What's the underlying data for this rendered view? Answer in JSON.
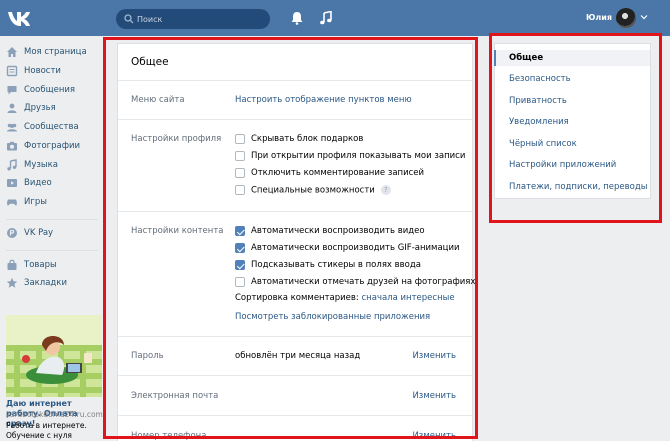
{
  "header": {
    "logo": "VK",
    "search_placeholder": "Поиск",
    "username": "Юлия",
    "icons": [
      "vk-logo-icon",
      "search-icon",
      "bell-icon",
      "music-icon",
      "chevron-down-icon"
    ]
  },
  "sidebar": {
    "items": [
      {
        "label": "Моя страница",
        "icon": "home-icon"
      },
      {
        "label": "Новости",
        "icon": "news-icon"
      },
      {
        "label": "Сообщения",
        "icon": "chat-icon"
      },
      {
        "label": "Друзья",
        "icon": "friend-icon"
      },
      {
        "label": "Сообщества",
        "icon": "group-icon"
      },
      {
        "label": "Фотографии",
        "icon": "camera-icon"
      },
      {
        "label": "Музыка",
        "icon": "music-icon"
      },
      {
        "label": "Видео",
        "icon": "video-icon"
      },
      {
        "label": "Игры",
        "icon": "gamepad-icon"
      },
      {
        "label": "VK Pay",
        "icon": "vkpay-icon"
      },
      {
        "label": "Товары",
        "icon": "bag-icon"
      },
      {
        "label": "Закладки",
        "icon": "star-icon"
      }
    ],
    "ad": {
      "title": "Даю интернет работу. Оплата сразу!",
      "domain": "zarabotokdoma24.ru.com",
      "text": "Работа в интернете. Обучение с нуля"
    }
  },
  "settings": {
    "title": "Общее",
    "menu": {
      "label": "Меню сайта",
      "link": "Настроить отображение пунктов меню"
    },
    "profile": {
      "label": "Настройки профиля",
      "options": [
        {
          "text": "Скрывать блок подарков",
          "checked": false
        },
        {
          "text": "При открытии профиля показывать мои записи",
          "checked": false
        },
        {
          "text": "Отключить комментирование записей",
          "checked": false
        },
        {
          "text": "Специальные возможности",
          "checked": false,
          "help": "?"
        }
      ]
    },
    "content": {
      "label": "Настройки контента",
      "options": [
        {
          "text": "Автоматически воспроизводить видео",
          "checked": true
        },
        {
          "text": "Автоматически воспроизводить GIF-анимации",
          "checked": true
        },
        {
          "text": "Подсказывать стикеры в полях ввода",
          "checked": true
        },
        {
          "text": "Автоматически отмечать друзей на фотографиях",
          "checked": false
        }
      ],
      "sort_label": "Сортировка комментариев:",
      "sort_value": "сначала интересные",
      "blocked_apps_link": "Посмотреть заблокированные приложения"
    },
    "password": {
      "label": "Пароль",
      "value": "обновлён три месяца назад",
      "action": "Изменить"
    },
    "email": {
      "label": "Электронная почта",
      "value": "",
      "action": "Изменить"
    },
    "phone": {
      "label": "Номер телефона",
      "value": "",
      "action": "Изменить"
    }
  },
  "right_menu": {
    "items": [
      {
        "label": "Общее",
        "active": true
      },
      {
        "label": "Безопасность",
        "active": false
      },
      {
        "label": "Приватность",
        "active": false
      },
      {
        "label": "Уведомления",
        "active": false
      },
      {
        "label": "Чёрный список",
        "active": false
      },
      {
        "label": "Настройки приложений",
        "active": false
      },
      {
        "label": "Платежи, подписки, переводы",
        "active": false
      }
    ]
  },
  "colors": {
    "header": "#4a76a8",
    "link": "#2a5885",
    "checkbox_on": "#5181b8",
    "highlight_frame": "#e1141c",
    "background": "#edeef0"
  }
}
